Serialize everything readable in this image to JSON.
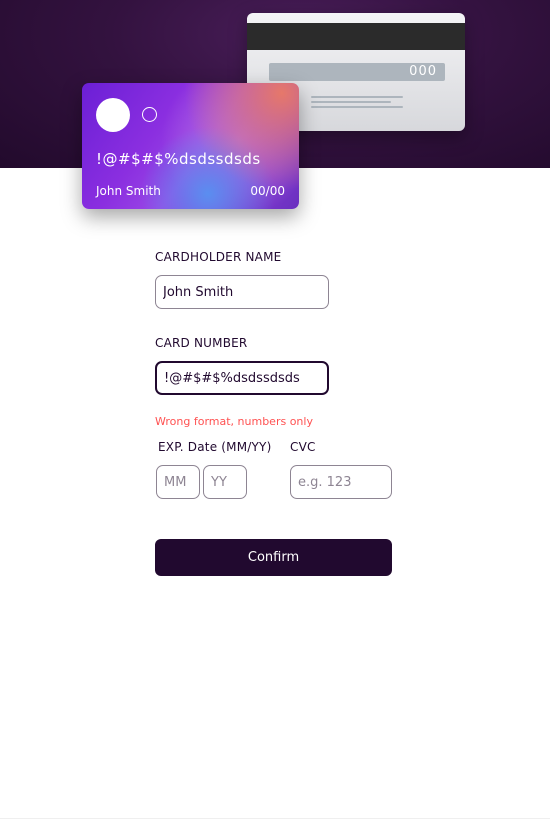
{
  "card_back": {
    "cvc_value": "000"
  },
  "card_front": {
    "number": "!@#$#$%dsdssdsds",
    "holder": "John Smith",
    "expiry": "00/00"
  },
  "form": {
    "cardholder_label": "CARDHOLDER NAME",
    "cardholder_value": "John Smith",
    "number_label": "CARD NUMBER",
    "number_value": "!@#$#$%dsdssdsds",
    "number_error": "Wrong format, numbers only",
    "exp_label": "EXP. Date (MM/YY)",
    "mm_placeholder": "MM",
    "yy_placeholder": "YY",
    "cvc_label": "CVC",
    "cvc_placeholder": "e.g. 123",
    "confirm_label": "Confirm"
  },
  "colors": {
    "dark_violet": "#21092f",
    "error_red": "#ff5252",
    "border_gray": "#8e8593"
  }
}
